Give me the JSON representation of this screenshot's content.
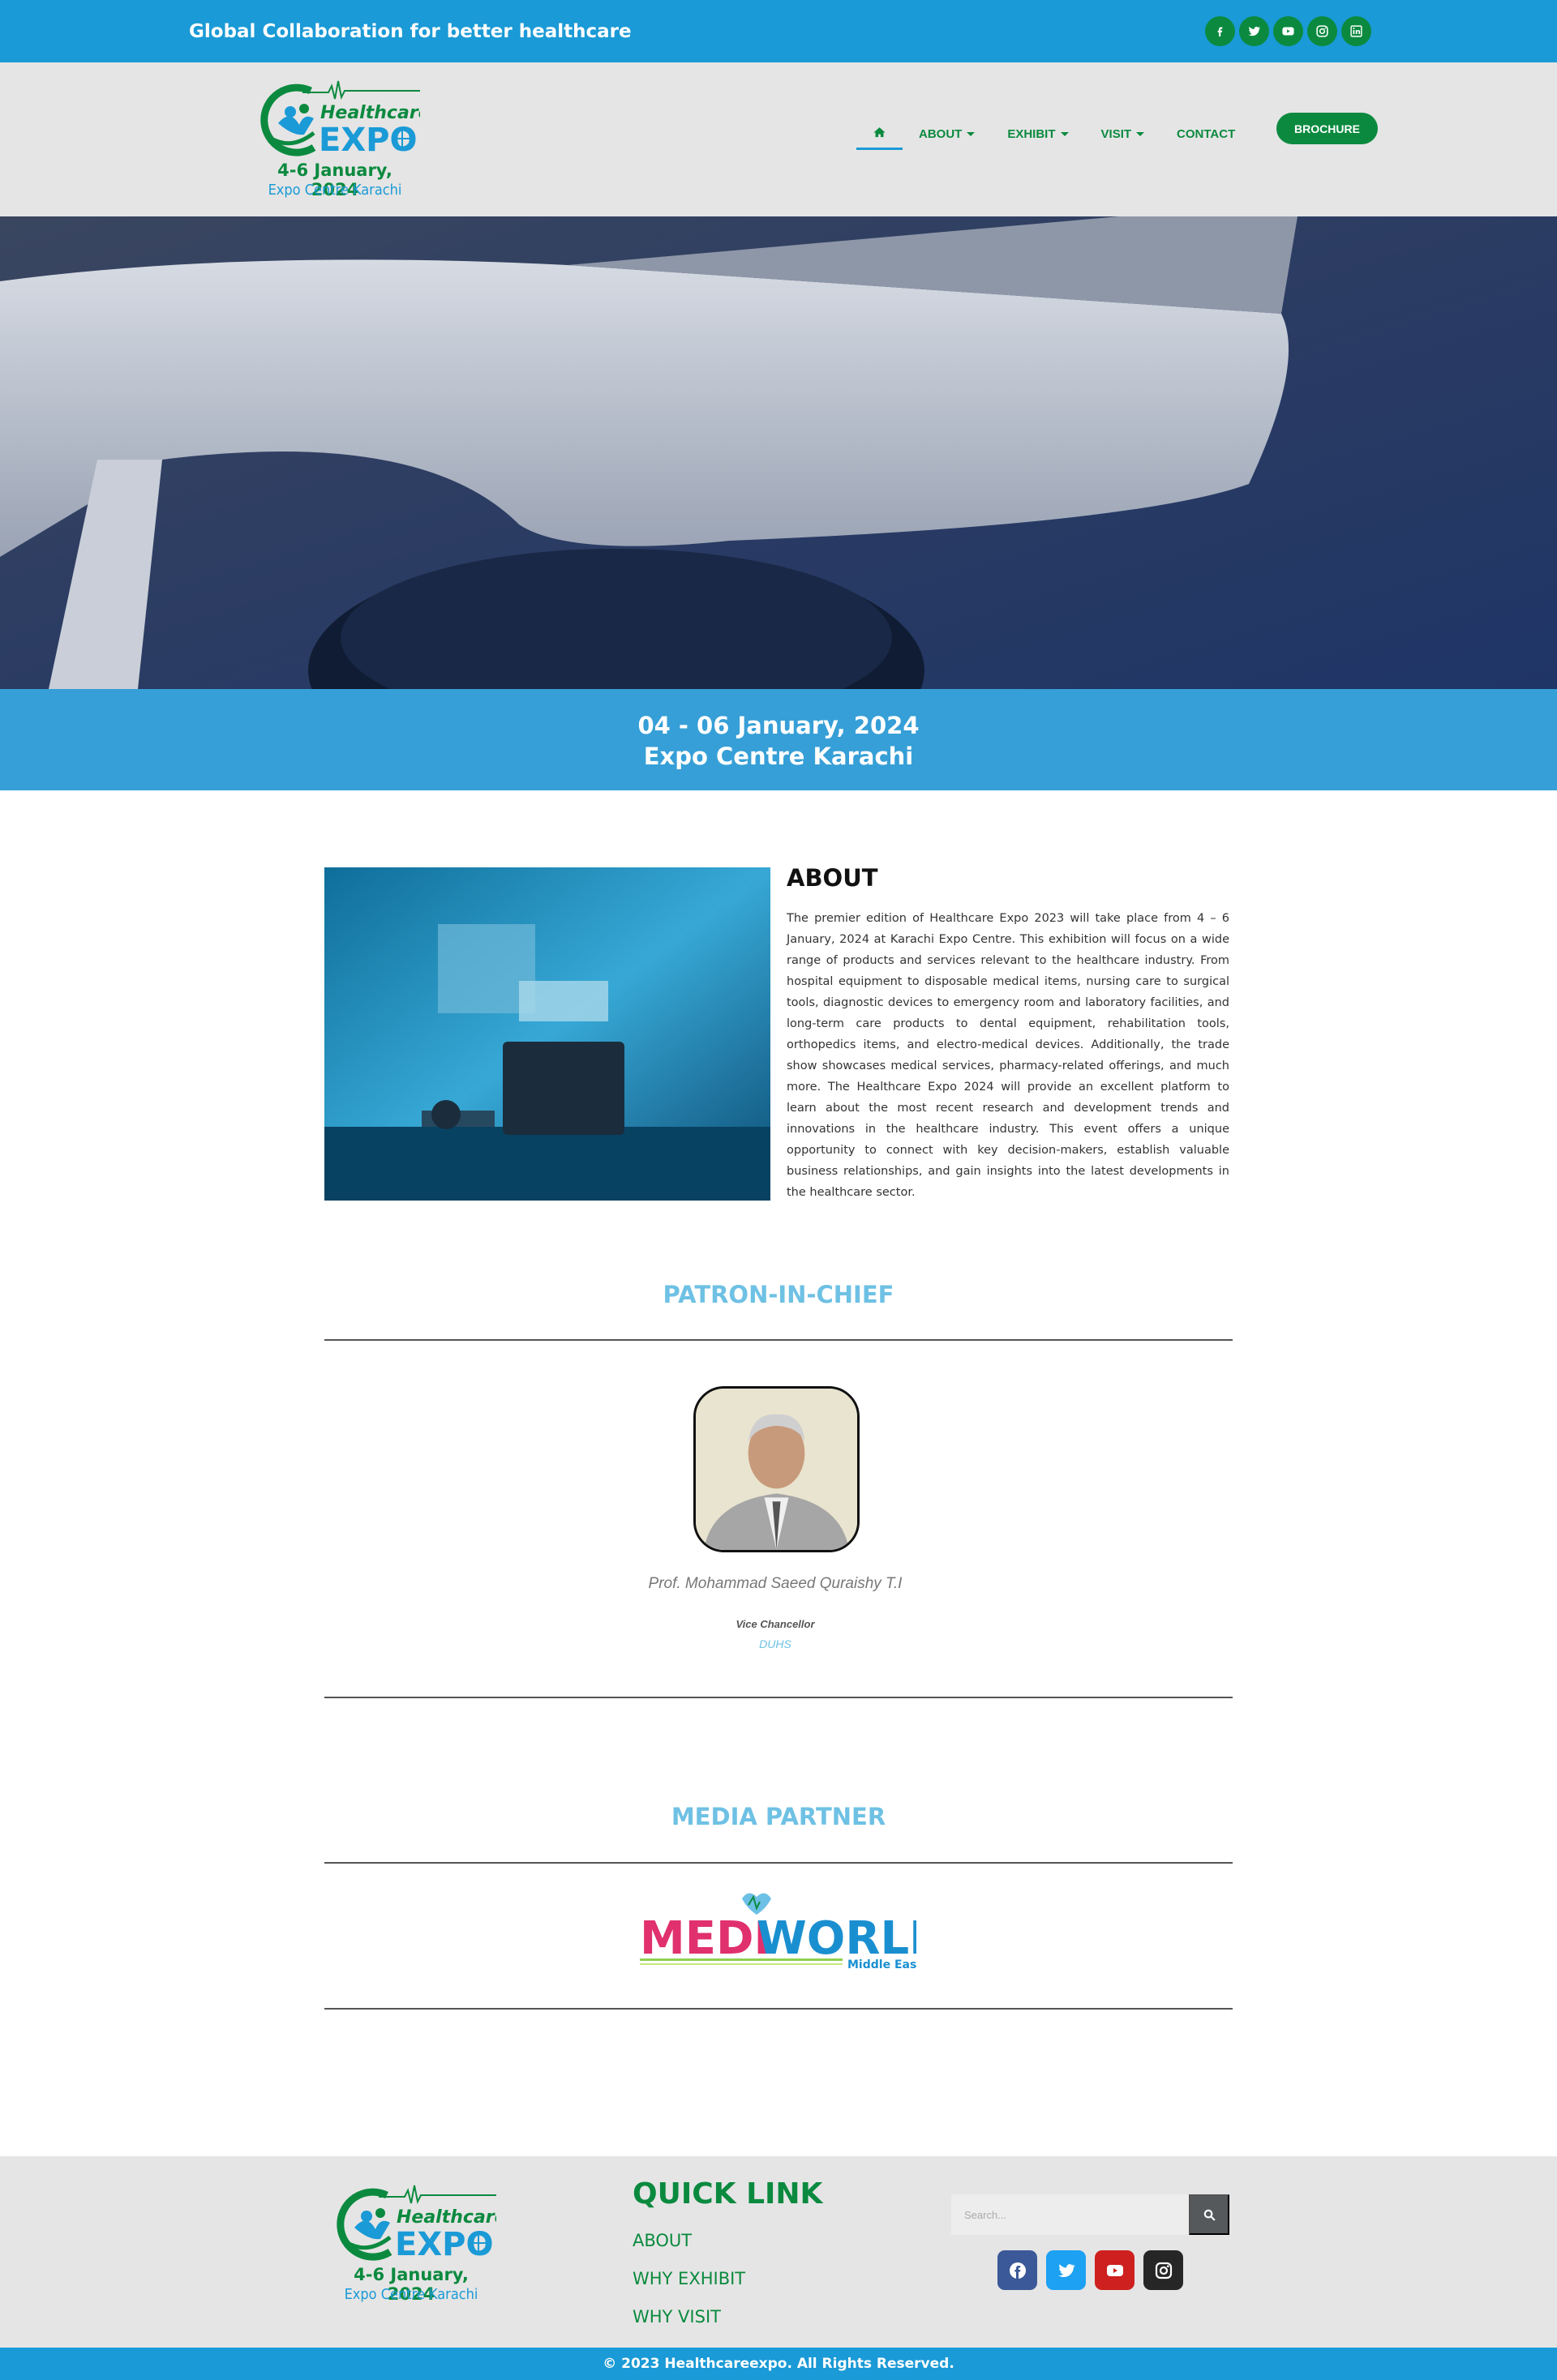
{
  "topbar": {
    "tagline": "Global Collaboration for better healthcare",
    "social_icons": [
      "facebook-icon",
      "twitter-icon",
      "youtube-icon",
      "instagram-icon",
      "linkedin-icon"
    ]
  },
  "logo": {
    "line1": "Healthcare",
    "line2": "EXPO",
    "date": "4-6 January, 2024",
    "venue": "Expo Centre Karachi"
  },
  "nav": {
    "home_icon": "home-icon",
    "items": [
      "ABOUT",
      "EXHIBIT",
      "VISIT",
      "CONTACT"
    ],
    "brochure": "BROCHURE"
  },
  "band": {
    "dates": "04 - 06 January, 2024",
    "venue": "Expo Centre Karachi"
  },
  "about": {
    "title": "ABOUT",
    "text": "The premier edition of Healthcare Expo 2023 will take place from 4 – 6 January, 2024 at Karachi Expo Centre. This exhibition will focus on a wide range of products and services relevant to the healthcare industry. From hospital equipment to disposable medical items, nursing care to surgical tools, diagnostic devices to emergency room and laboratory facilities, and long-term care products to dental equipment, rehabilitation tools, orthopedics items, and electro-medical devices. Additionally, the trade show showcases medical services, pharmacy-related offerings, and much more. The Healthcare Expo 2024 will provide an excellent platform to learn about the most recent research and development trends and innovations in the healthcare industry. This event offers a unique opportunity to connect with key decision-makers, establish valuable business relationships, and gain insights into the latest developments in the healthcare sector."
  },
  "patron": {
    "title": "PATRON-IN-CHIEF",
    "name": "Prof. Mohammad Saeed Quraishy T.I",
    "role": "Vice Chancellor",
    "org": "DUHS"
  },
  "media": {
    "title": "MEDIA PARTNER",
    "logo_medi": "MEDI",
    "logo_world": "WORLD",
    "logo_sub": "Middle East"
  },
  "footer": {
    "quick_link_title": "QUICK LINK",
    "links": [
      "ABOUT",
      "WHY EXHIBIT",
      "WHY VISIT"
    ],
    "search_placeholder": "Search...",
    "social_icons": [
      "facebook-icon",
      "twitter-icon",
      "youtube-icon",
      "instagram-icon"
    ],
    "copyright": "© 2023 Healthcareexpo. All Rights Reserved."
  },
  "colors": {
    "primary_blue": "#1a9ad6",
    "brand_green": "#0b8a3f",
    "light_blue_heading": "#6ec1e4",
    "header_gray": "#e5e5e5"
  }
}
